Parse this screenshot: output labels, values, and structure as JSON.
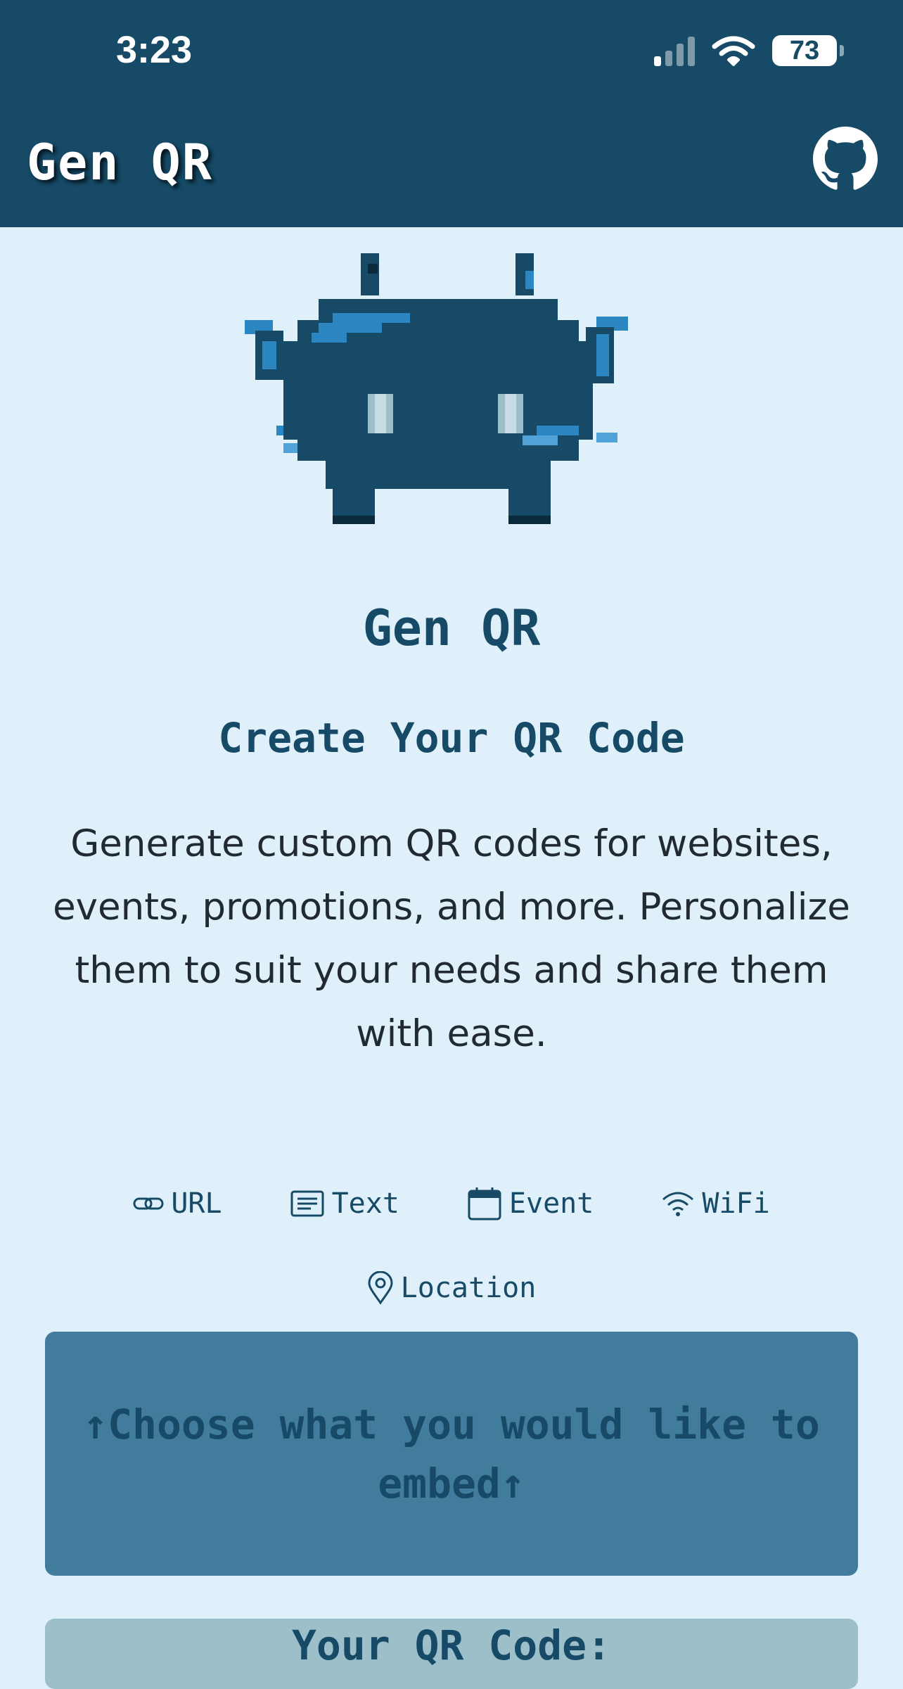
{
  "status_bar": {
    "time": "3:23",
    "battery": "73"
  },
  "header": {
    "title": "Gen QR",
    "github_icon": "github-icon"
  },
  "hero": {
    "title": "Gen QR",
    "subtitle": "Create Your QR Code",
    "description": "Generate custom QR codes for websites, events, promotions, and more. Personalize them to suit your needs and share them with ease."
  },
  "tabs": [
    {
      "label": "URL",
      "icon": "link-icon"
    },
    {
      "label": "Text",
      "icon": "text-icon"
    },
    {
      "label": "Event",
      "icon": "calendar-icon"
    },
    {
      "label": "WiFi",
      "icon": "wifi-icon"
    },
    {
      "label": "Location",
      "icon": "location-pin-icon"
    }
  ],
  "embed_prompt": "↑Choose what you would like to embed↑",
  "qr_section": {
    "title": "Your QR Code:"
  },
  "colors": {
    "header": "#164a66",
    "background": "#dff0fb",
    "panel": "#427c9d",
    "accent": "#164a66"
  }
}
